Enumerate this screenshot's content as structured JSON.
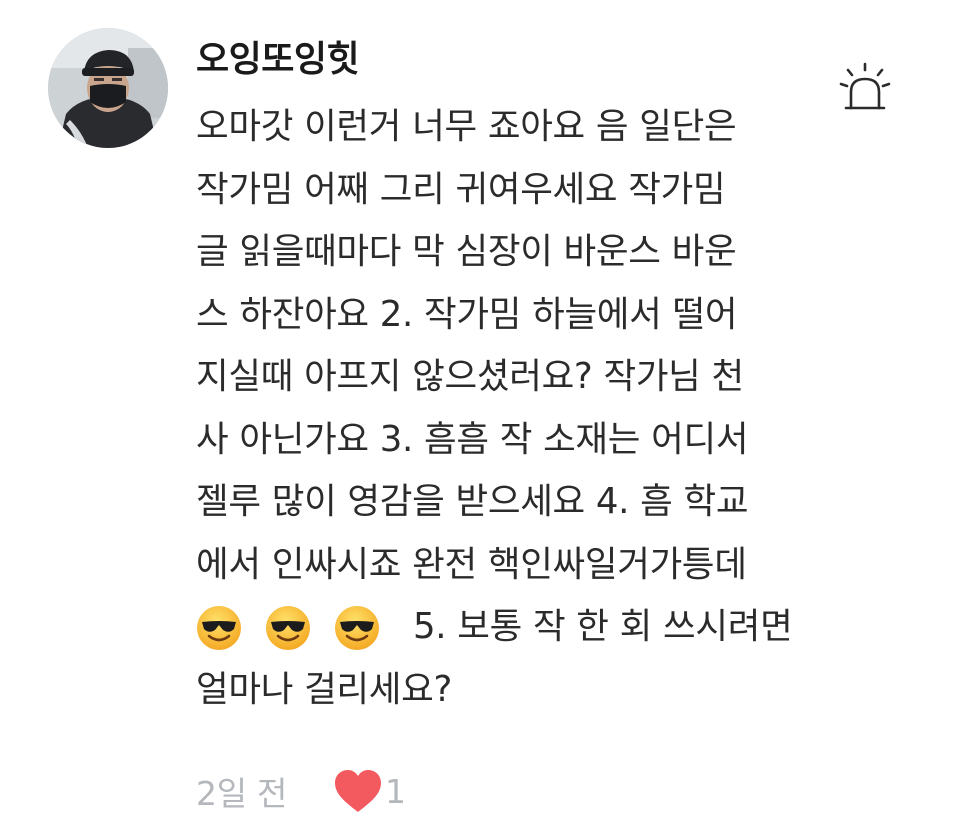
{
  "comment": {
    "username": "오잉또잉힛",
    "lines": [
      "오마갓 이런거 너무 죠아요 음 일단은",
      "작가밈 어째 그리 귀여우세요 작가밈",
      "글 읽을때마다 막 심장이 바운스 바운",
      "스 하잔아요 2. 작가밈 하늘에서 떨어",
      "지실때 아프지 않으셨러요? 작가님 천",
      "사 아닌가요 3. 흠흠 작 소재는 어디서",
      "젤루 많이 영감을 받으세요 4. 흠 학교",
      "에서 인싸시죠 완전 핵인싸일거가틍데"
    ],
    "emoji_line_text": "5. 보통 작 한 회 쓰시려면",
    "last_line": "얼마나 걸리세요?",
    "emojis": [
      "sunglasses-face",
      "sunglasses-face",
      "sunglasses-face"
    ],
    "timestamp": "2일 전",
    "like_count": "1",
    "icons": {
      "report": "siren-alarm-icon",
      "like": "heart-icon"
    },
    "colors": {
      "heart": "#f25a5f",
      "meta_text": "#b4b8bd",
      "body_text": "#2b2b2b"
    }
  }
}
